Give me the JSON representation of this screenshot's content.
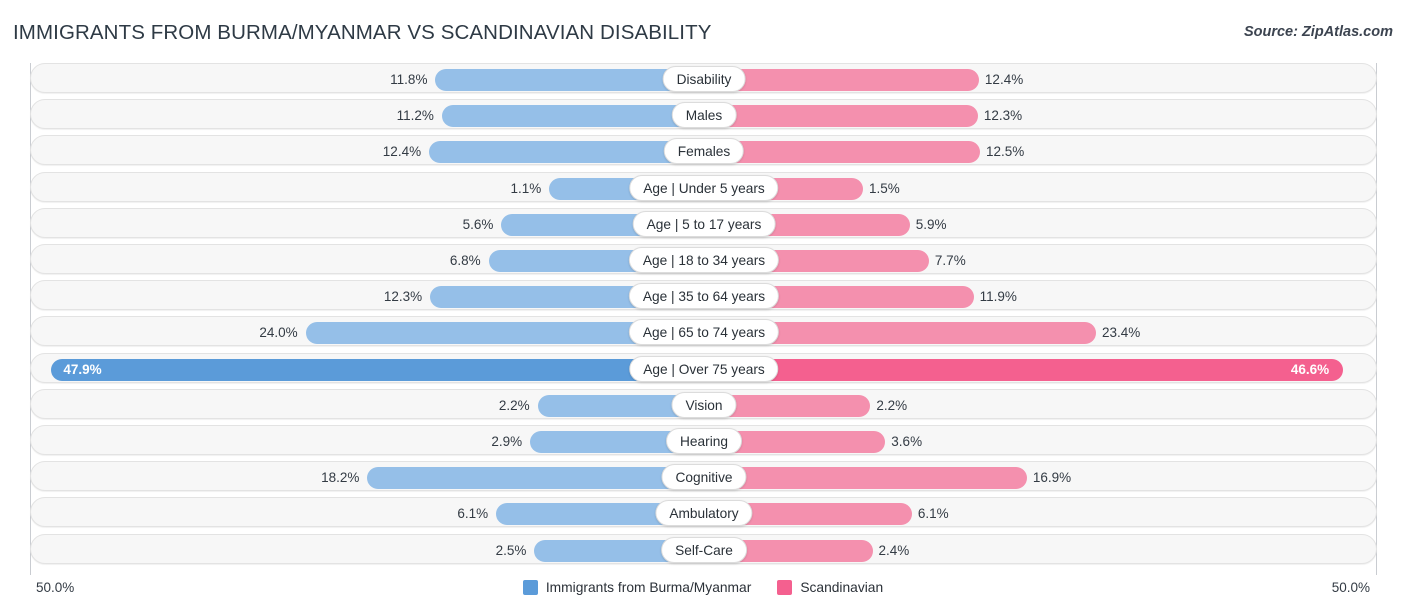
{
  "header": {
    "title": "IMMIGRANTS FROM BURMA/MYANMAR VS SCANDINAVIAN DISABILITY",
    "source": "Source: ZipAtlas.com"
  },
  "axis": {
    "left_end": "50.0%",
    "right_end": "50.0%",
    "max_percent": 50.0
  },
  "legend": {
    "items": [
      {
        "label": "Immigrants from Burma/Myanmar",
        "color": "#5b9bd9"
      },
      {
        "label": "Scandinavian",
        "color": "#f4608f"
      }
    ]
  },
  "colors": {
    "left_bar": "#95bfe8",
    "right_bar": "#f490ae",
    "left_bar_highlight": "#5b9bd9",
    "right_bar_highlight": "#f4608f",
    "row_background": "#f7f7f7",
    "title_text": "#2e3a45"
  },
  "chart_data": {
    "type": "bar",
    "orientation": "horizontal-diverging",
    "title": "IMMIGRANTS FROM BURMA/MYANMAR VS SCANDINAVIAN DISABILITY",
    "xlabel": "",
    "ylabel": "",
    "xlim": [
      -50.0,
      50.0
    ],
    "grid": false,
    "legend_position": "bottom-center",
    "categories": [
      "Disability",
      "Males",
      "Females",
      "Age | Under 5 years",
      "Age | 5 to 17 years",
      "Age | 18 to 34 years",
      "Age | 35 to 64 years",
      "Age | 65 to 74 years",
      "Age | Over 75 years",
      "Vision",
      "Hearing",
      "Cognitive",
      "Ambulatory",
      "Self-Care"
    ],
    "series": [
      {
        "name": "Immigrants from Burma/Myanmar",
        "color": "#95bfe8",
        "values": [
          11.8,
          11.2,
          12.4,
          1.1,
          5.6,
          6.8,
          12.3,
          24.0,
          47.9,
          2.2,
          2.9,
          18.2,
          6.1,
          2.5
        ],
        "labels": [
          "11.8%",
          "11.2%",
          "12.4%",
          "1.1%",
          "5.6%",
          "6.8%",
          "12.3%",
          "24.0%",
          "47.9%",
          "2.2%",
          "2.9%",
          "18.2%",
          "6.1%",
          "2.5%"
        ]
      },
      {
        "name": "Scandinavian",
        "color": "#f490ae",
        "values": [
          12.4,
          12.3,
          12.5,
          1.5,
          5.9,
          7.7,
          11.9,
          23.4,
          46.6,
          2.2,
          3.6,
          16.9,
          6.1,
          2.4
        ],
        "labels": [
          "12.4%",
          "12.3%",
          "12.5%",
          "1.5%",
          "5.9%",
          "7.7%",
          "11.9%",
          "23.4%",
          "46.6%",
          "2.2%",
          "3.6%",
          "16.9%",
          "6.1%",
          "2.4%"
        ]
      }
    ],
    "highlighted_category": "Age | Over 75 years"
  },
  "rows": [
    {
      "label": "Disability",
      "left": "11.8%",
      "right": "12.4%",
      "lv": 11.8,
      "rv": 12.4,
      "hl": false
    },
    {
      "label": "Males",
      "left": "11.2%",
      "right": "12.3%",
      "lv": 11.2,
      "rv": 12.3,
      "hl": false
    },
    {
      "label": "Females",
      "left": "12.4%",
      "right": "12.5%",
      "lv": 12.4,
      "rv": 12.5,
      "hl": false
    },
    {
      "label": "Age | Under 5 years",
      "left": "1.1%",
      "right": "1.5%",
      "lv": 1.1,
      "rv": 1.5,
      "hl": false
    },
    {
      "label": "Age | 5 to 17 years",
      "left": "5.6%",
      "right": "5.9%",
      "lv": 5.6,
      "rv": 5.9,
      "hl": false
    },
    {
      "label": "Age | 18 to 34 years",
      "left": "6.8%",
      "right": "7.7%",
      "lv": 6.8,
      "rv": 7.7,
      "hl": false
    },
    {
      "label": "Age | 35 to 64 years",
      "left": "12.3%",
      "right": "11.9%",
      "lv": 12.3,
      "rv": 11.9,
      "hl": false
    },
    {
      "label": "Age | 65 to 74 years",
      "left": "24.0%",
      "right": "23.4%",
      "lv": 24.0,
      "rv": 23.4,
      "hl": false
    },
    {
      "label": "Age | Over 75 years",
      "left": "47.9%",
      "right": "46.6%",
      "lv": 47.9,
      "rv": 46.6,
      "hl": true
    },
    {
      "label": "Vision",
      "left": "2.2%",
      "right": "2.2%",
      "lv": 2.2,
      "rv": 2.2,
      "hl": false
    },
    {
      "label": "Hearing",
      "left": "2.9%",
      "right": "3.6%",
      "lv": 2.9,
      "rv": 3.6,
      "hl": false
    },
    {
      "label": "Cognitive",
      "left": "18.2%",
      "right": "16.9%",
      "lv": 18.2,
      "rv": 16.9,
      "hl": false
    },
    {
      "label": "Ambulatory",
      "left": "6.1%",
      "right": "6.1%",
      "lv": 6.1,
      "rv": 6.1,
      "hl": false
    },
    {
      "label": "Self-Care",
      "left": "2.5%",
      "right": "2.4%",
      "lv": 2.5,
      "rv": 2.4,
      "hl": false
    }
  ]
}
